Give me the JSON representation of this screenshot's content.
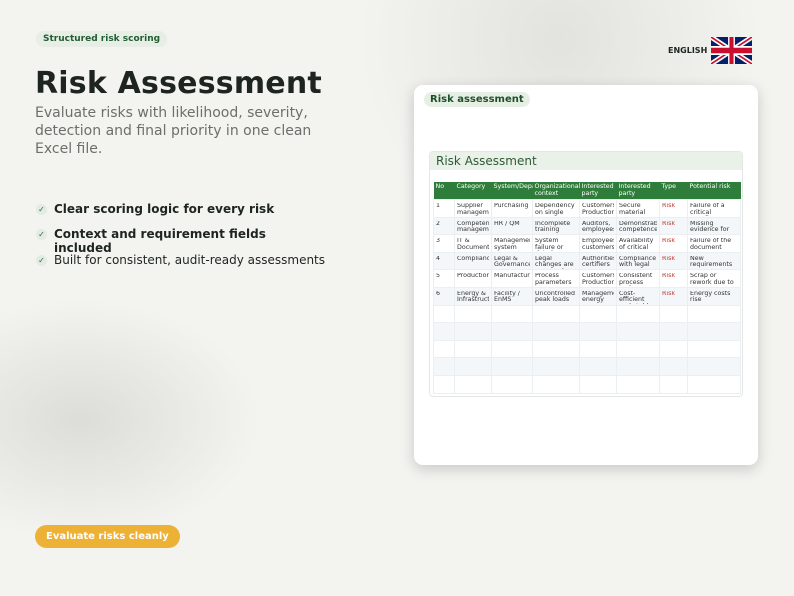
{
  "badge": "Structured risk scoring",
  "title": "Risk Assessment",
  "subtitle": "Evaluate risks with likelihood, severity, detection and final priority in one clean Excel file.",
  "features": [
    {
      "text": "Clear scoring logic for every risk",
      "bold": true
    },
    {
      "text": "Context and requirement fields included",
      "bold": true
    },
    {
      "text": "Built for consistent, audit-ready assessments",
      "bold": false
    }
  ],
  "cta": "Evaluate risks cleanly",
  "language": "ENGLISH",
  "flag_icon": "uk-flag-icon",
  "accent_colors": {
    "green": "#2e7d3a",
    "yellow": "#edb135",
    "risk_red": "#c0392b"
  },
  "card": {
    "tag": "Risk assessment",
    "sheet_title": "Risk Assessment",
    "columns": [
      "No",
      "Category",
      "System/Department",
      "Organizational context",
      "Interested party",
      "Interested party",
      "Type",
      "Potential risk"
    ],
    "rows": [
      [
        "1",
        "Supplier management",
        "Purchasing",
        "Dependency on single",
        "Customers, Production",
        "Secure material",
        "Risk",
        "Failure of a critical supplier"
      ],
      [
        "2",
        "Competence management",
        "HR / QM",
        "Incomplete training",
        "Auditors, employees",
        "Demonstrable competence",
        "Risk",
        "Missing evidence for"
      ],
      [
        "3",
        "IT & Documentation",
        "Management system",
        "System failure or data loss",
        "Employees, customers",
        "Availability of critical",
        "Risk",
        "Failure of the document"
      ],
      [
        "4",
        "Compliance",
        "Legal & Governance",
        "Legal changes are assessed",
        "Authorities, certifiers",
        "Compliance with legal",
        "Risk",
        "New requirements"
      ],
      [
        "5",
        "Production",
        "Manufacturing",
        "Process parameters",
        "Customers, Production",
        "Consistent process and",
        "Risk",
        "Scrap or rework due to process"
      ],
      [
        "6",
        "Energy & Infrastructure",
        "Facility / EnMS",
        "Uncontrolled peak loads",
        "Management energy",
        "Cost-efficient and stable",
        "Risk",
        "Energy costs rise"
      ]
    ]
  }
}
